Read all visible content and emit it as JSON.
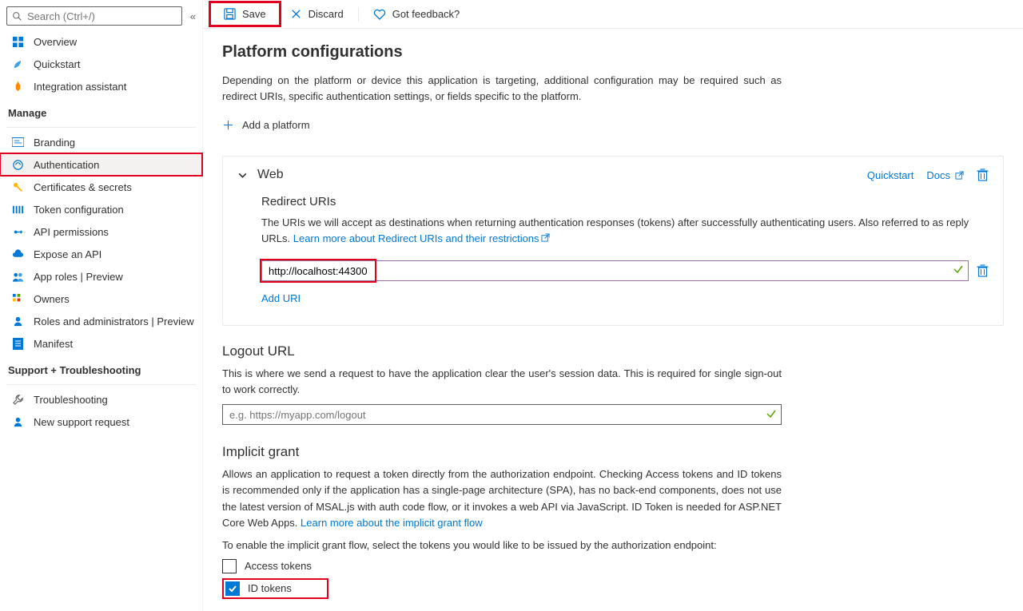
{
  "search": {
    "placeholder": "Search (Ctrl+/)"
  },
  "sidebar": {
    "top": [
      {
        "label": "Overview"
      },
      {
        "label": "Quickstart"
      },
      {
        "label": "Integration assistant"
      }
    ],
    "manage_header": "Manage",
    "manage": [
      {
        "label": "Branding"
      },
      {
        "label": "Authentication"
      },
      {
        "label": "Certificates & secrets"
      },
      {
        "label": "Token configuration"
      },
      {
        "label": "API permissions"
      },
      {
        "label": "Expose an API"
      },
      {
        "label": "App roles | Preview"
      },
      {
        "label": "Owners"
      },
      {
        "label": "Roles and administrators | Preview"
      },
      {
        "label": "Manifest"
      }
    ],
    "support_header": "Support + Troubleshooting",
    "support": [
      {
        "label": "Troubleshooting"
      },
      {
        "label": "New support request"
      }
    ]
  },
  "toolbar": {
    "save": "Save",
    "discard": "Discard",
    "feedback": "Got feedback?"
  },
  "page": {
    "title": "Platform configurations",
    "desc": "Depending on the platform or device this application is targeting, additional configuration may be required such as redirect URIs, specific authentication settings, or fields specific to the platform.",
    "add_platform": "Add a platform"
  },
  "web": {
    "title": "Web",
    "quickstart": "Quickstart",
    "docs": "Docs",
    "redirect_title": "Redirect URIs",
    "redirect_desc": "The URIs we will accept as destinations when returning authentication responses (tokens) after successfully authenticating users. Also referred to as reply URLs. ",
    "learn_more": "Learn more about Redirect URIs and their restrictions",
    "uri_value": "http://localhost:44300",
    "add_uri": "Add URI"
  },
  "logout": {
    "title": "Logout URL",
    "desc": "This is where we send a request to have the application clear the user's session data. This is required for single sign-out to work correctly.",
    "placeholder": "e.g. https://myapp.com/logout"
  },
  "implicit": {
    "title": "Implicit grant",
    "desc": "Allows an application to request a token directly from the authorization endpoint. Checking Access tokens and ID tokens is recommended only if the application has a single-page architecture (SPA), has no back-end components, does not use the latest version of MSAL.js with auth code flow, or it invokes a web API via JavaScript. ID Token is needed for ASP.NET Core Web Apps. ",
    "learn_more": "Learn more about the implicit grant flow",
    "enable_text": "To enable the implicit grant flow, select the tokens you would like to be issued by the authorization endpoint:",
    "access_tokens": "Access tokens",
    "id_tokens": "ID tokens"
  }
}
